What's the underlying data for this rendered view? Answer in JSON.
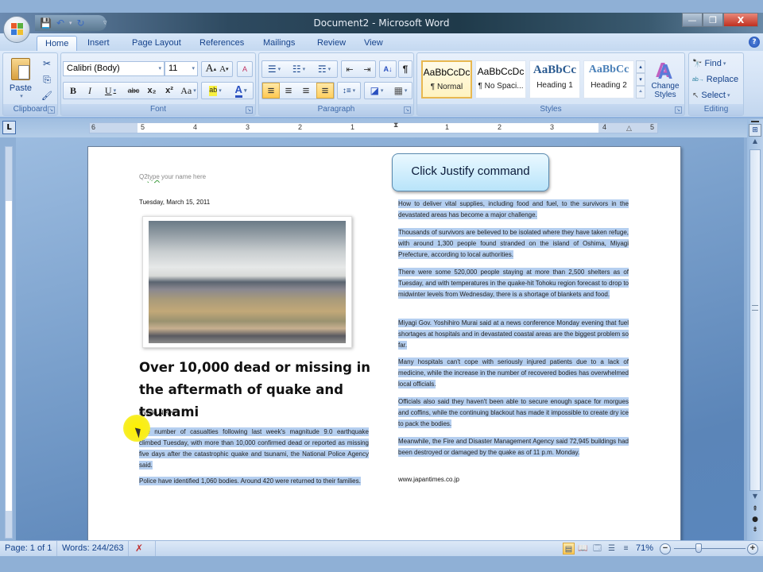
{
  "window": {
    "title": "Document2 - Microsoft Word",
    "controls": {
      "minimize": "—",
      "maximize": "❐",
      "close": "X"
    }
  },
  "quick_access": {
    "save_icon": "save-icon",
    "undo_icon": "undo-icon",
    "redo_icon": "redo-icon",
    "customize_icon": "customize-qat-icon"
  },
  "tabs": [
    {
      "label": "Home",
      "active": true
    },
    {
      "label": "Insert"
    },
    {
      "label": "Page Layout"
    },
    {
      "label": "References"
    },
    {
      "label": "Mailings"
    },
    {
      "label": "Review"
    },
    {
      "label": "View"
    }
  ],
  "help": "?",
  "ribbon": {
    "clipboard": {
      "label": "Clipboard",
      "paste": "Paste",
      "cut_icon": "✂",
      "copy_icon": "⎘",
      "format_painter_icon": "🖌"
    },
    "font": {
      "label": "Font",
      "font_name": "Calibri (Body)",
      "font_size": "11",
      "grow": "A",
      "shrink": "A",
      "clear": "A",
      "bold": "B",
      "italic": "I",
      "underline": "U",
      "strikethrough": "abc",
      "subscript": "x₂",
      "superscript": "x²",
      "change_case": "Aa",
      "highlight": "ab",
      "font_color": "A"
    },
    "paragraph": {
      "label": "Paragraph",
      "bullets": "☰",
      "numbering": "☷",
      "multilevel": "☶",
      "decrease_indent": "⇤",
      "increase_indent": "⇥",
      "sort": "A↓",
      "show_marks": "¶",
      "align_left": "≡",
      "center": "≡",
      "align_right": "≡",
      "justify": "≡",
      "line_spacing": "↕≡",
      "shading": "◪",
      "borders": "▦"
    },
    "styles": {
      "label": "Styles",
      "items": [
        {
          "sample": "AaBbCcDc",
          "name": "¶ Normal",
          "selected": true
        },
        {
          "sample": "AaBbCcDc",
          "name": "¶ No Spaci..."
        },
        {
          "sample": "AaBbCc",
          "name": "Heading 1"
        },
        {
          "sample": "AaBbCc",
          "name": "Heading 2"
        }
      ],
      "change_styles": "Change Styles"
    },
    "editing": {
      "label": "Editing",
      "find": "Find",
      "replace": "Replace",
      "select": "Select"
    }
  },
  "ruler": {
    "left_numbers": [
      "6",
      "5",
      "4",
      "3",
      "2",
      "1"
    ],
    "right_numbers": [
      "1",
      "2",
      "3",
      "4",
      "5"
    ],
    "tab_selector": "L"
  },
  "callout": {
    "text": "Click Justify command"
  },
  "document": {
    "name_line_prefix": "Q2",
    "name_line_squiggle": "type",
    "name_line_rest": " your name  here",
    "date": "Tuesday, March 15, 2011",
    "headline": "Over 10,000 dead or missing in the aftermath of quake and tsunami",
    "byline": "Kyodo News",
    "left_paragraphs": [
      "The number of casualties following last week's magnitude 9.0 earthquake climbed Tuesday, with more than 10,000 confirmed dead or reported as missing five days after the catastrophic quake and tsunami, the National Police Agency said.",
      "Police have identified 1,060 bodies. Around 420 were returned to their families."
    ],
    "right_paragraphs": [
      "How to deliver vital supplies, including food and fuel, to the survivors in the devastated areas has become a major challenge.",
      "Thousands of survivors are believed to be isolated where they have taken refuge, with around 1,300 people found stranded on the island of Oshima, Miyagi Prefecture, according to local authorities.",
      "There were some 520,000 people staying at more than 2,500 shelters as of Tuesday, and with temperatures in the quake-hit Tohoku region forecast to drop to midwinter levels from Wednesday, there is a shortage of blankets and food.",
      "Miyagi Gov. Yoshihiro Murai said at a news conference Monday evening that fuel shortages at hospitals and in devastated coastal areas are the biggest problem so far.",
      "Many hospitals can't cope with seriously injured patients due to a lack of medicine, while the increase in the number of recovered bodies has overwhelmed local officials.",
      "Officials also said they haven't been able to secure enough space for morgues and coffins, while the continuing blackout has made it impossible to create dry ice to pack the bodies.",
      "Meanwhile, the Fire and Disaster Management Agency said 72,945 buildings had been destroyed or damaged by the quake as of 11 p.m. Monday."
    ],
    "source": "www.japantimes.co.jp",
    "selection_color": "#b5cff0"
  },
  "statusbar": {
    "page": "Page: 1 of 1",
    "words": "Words: 244/263",
    "proofing_icon": "proofing-errors-icon",
    "zoom": "71%",
    "zoom_level_percent": 71,
    "zoom_out": "−",
    "zoom_in": "+"
  }
}
